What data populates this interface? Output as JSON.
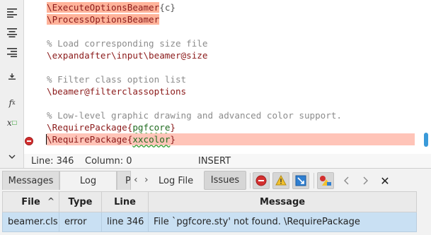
{
  "toolbar": {
    "icons": [
      "align-left-icon",
      "align-center-icon",
      "align-right-icon",
      "insert-icon",
      "function-icon",
      "subscript-icon",
      "chevron-down-icon"
    ],
    "function_label": "f",
    "function_sub": "x",
    "subscript_label": "x",
    "subscript_sub": "□"
  },
  "editor": {
    "lines": [
      {
        "cmd": "\\ExecuteOptionsBeamer",
        "brace_open": "{",
        "arg": "c",
        "brace_close": "}"
      },
      {
        "cmd": "\\ProcessOptionsBeamer"
      },
      {
        "text": ""
      },
      {
        "comment": "% Load corresponding size file"
      },
      {
        "cmd": "\\expandafter\\input\\beamer@size"
      },
      {
        "text": ""
      },
      {
        "comment": "% Filter class option list"
      },
      {
        "cmd": "\\beamer@filterclassoptions"
      },
      {
        "text": ""
      },
      {
        "comment": "% Low-level graphic drawing and advanced color support."
      },
      {
        "cmd": "\\RequirePackage",
        "brace_open": "{",
        "arg": "pgfcore",
        "brace_close": "}"
      },
      {
        "cmd": "\\RequirePackage",
        "brace_open": "{",
        "arg": "xxcolor",
        "brace_close": "}"
      }
    ],
    "status": {
      "line": "Line: 346",
      "column": "Column: 0",
      "mode": "INSERT"
    },
    "accent_color": "#3a9ad9",
    "error_color": "#d32f2f"
  },
  "panel": {
    "tabs": [
      "Messages",
      "Log",
      "P"
    ],
    "active_tab": "Log",
    "log_file_label": "Log File",
    "issues_label": "Issues",
    "nav_prev": "‹",
    "nav_next": "›",
    "close_label": "✕",
    "table": {
      "headers": [
        "File",
        "Type",
        "Line",
        "Message"
      ],
      "rows": [
        [
          "beamer.cls",
          "error",
          "line 346",
          "File `pgfcore.sty' not found. \\RequirePackage"
        ]
      ]
    }
  }
}
